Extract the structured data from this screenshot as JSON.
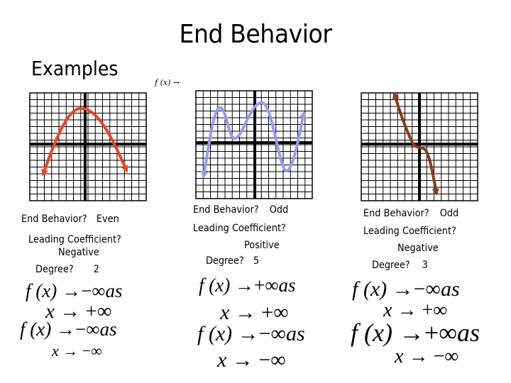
{
  "slide": {
    "title": "End Behavior",
    "subtitle": "Examples",
    "annotation": "f (x) →"
  },
  "examples": [
    {
      "curve_color": "#f0421c",
      "curve_description": "downward-opening parabola",
      "end_behavior_label": "End Behavior?",
      "end_behavior_value": "Even",
      "leading_coefficient_label": "Leading Coefficient?",
      "leading_coefficient_value": "Negative",
      "degree_label": "Degree?",
      "degree_value": "2",
      "limits": [
        {
          "lhs": "f (x)",
          "arrow": "→",
          "target": "−∞",
          "suffix": "as"
        },
        {
          "lhs": "x",
          "arrow": "→",
          "target": "+∞",
          "suffix": ""
        },
        {
          "lhs": "f (x)",
          "arrow": "→",
          "target": "−∞",
          "suffix": "as"
        },
        {
          "lhs": "x",
          "arrow": "→",
          "target": "−∞",
          "suffix": ""
        }
      ]
    },
    {
      "curve_color": "#9a9af0",
      "curve_description": "quintic with two peaks and two troughs, rising right",
      "end_behavior_label": "End Behavior?",
      "end_behavior_value": "Odd",
      "leading_coefficient_label": "Leading Coefficient?",
      "leading_coefficient_value": "Positive",
      "degree_label": "Degree?",
      "degree_value": "5",
      "limits": [
        {
          "lhs": "f (x)",
          "arrow": "→",
          "target": "+∞",
          "suffix": "as"
        },
        {
          "lhs": "x",
          "arrow": "→",
          "target": "+∞",
          "suffix": ""
        },
        {
          "lhs": "f (x)",
          "arrow": "→",
          "target": "−∞",
          "suffix": "as"
        },
        {
          "lhs": "x",
          "arrow": "→",
          "target": "−∞",
          "suffix": ""
        }
      ]
    },
    {
      "curve_color": "#8b3a12",
      "curve_description": "cubic falling left to right",
      "end_behavior_label": "End Behavior?",
      "end_behavior_value": "Odd",
      "leading_coefficient_label": "Leading Coefficient?",
      "leading_coefficient_value": "Negative",
      "degree_label": "Degree?",
      "degree_value": "3",
      "limits": [
        {
          "lhs": "f (x)",
          "arrow": "→",
          "target": "−∞",
          "suffix": "as"
        },
        {
          "lhs": "x",
          "arrow": "→",
          "target": "+∞",
          "suffix": ""
        },
        {
          "lhs": "f (x)",
          "arrow": "→",
          "target": "+∞",
          "suffix": "as"
        },
        {
          "lhs": "x",
          "arrow": "→",
          "target": "−∞",
          "suffix": ""
        }
      ]
    }
  ]
}
